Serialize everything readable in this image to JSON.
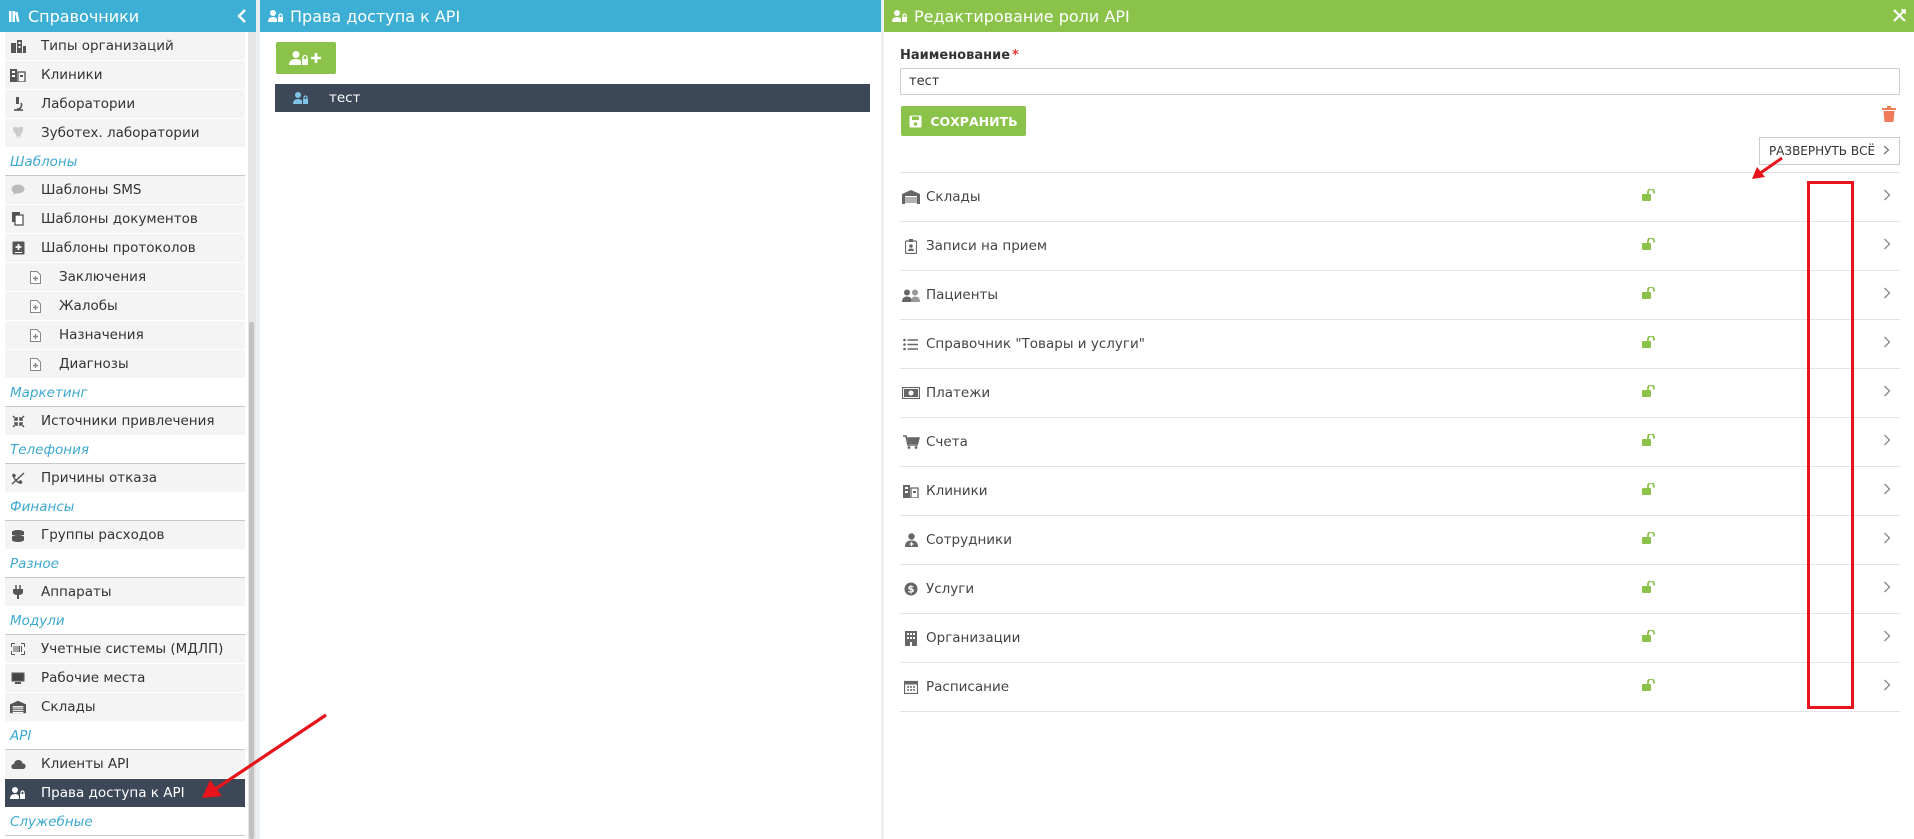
{
  "sidebar": {
    "title": "Справочники",
    "items": [
      {
        "kind": "item",
        "label": "Типы организаций",
        "icon": "buildings-icon"
      },
      {
        "kind": "item",
        "label": "Клиники",
        "icon": "clinic-icon"
      },
      {
        "kind": "item",
        "label": "Лаборатории",
        "icon": "microscope-icon"
      },
      {
        "kind": "item",
        "label": "Зуботех. лаборатории",
        "icon": "tooth-icon"
      },
      {
        "kind": "section",
        "label": "Шаблоны"
      },
      {
        "kind": "item",
        "label": "Шаблоны SMS",
        "icon": "sms-icon"
      },
      {
        "kind": "item",
        "label": "Шаблоны документов",
        "icon": "documents-icon"
      },
      {
        "kind": "item",
        "label": "Шаблоны протоколов",
        "icon": "protocol-icon"
      },
      {
        "kind": "sub",
        "label": "Заключения",
        "icon": "file-icon"
      },
      {
        "kind": "sub",
        "label": "Жалобы",
        "icon": "file-icon"
      },
      {
        "kind": "sub",
        "label": "Назначения",
        "icon": "file-icon"
      },
      {
        "kind": "sub",
        "label": "Диагнозы",
        "icon": "file-icon"
      },
      {
        "kind": "section",
        "label": "Маркетинг"
      },
      {
        "kind": "item",
        "label": "Источники привлечения",
        "icon": "compress-icon"
      },
      {
        "kind": "section",
        "label": "Телефония"
      },
      {
        "kind": "item",
        "label": "Причины отказа",
        "icon": "phone-off-icon"
      },
      {
        "kind": "section",
        "label": "Финансы"
      },
      {
        "kind": "item",
        "label": "Группы расходов",
        "icon": "coins-icon"
      },
      {
        "kind": "section",
        "label": "Разное"
      },
      {
        "kind": "item",
        "label": "Аппараты",
        "icon": "plug-icon"
      },
      {
        "kind": "section",
        "label": "Модули"
      },
      {
        "kind": "item",
        "label": "Учетные системы (МДЛП)",
        "icon": "barcode-icon"
      },
      {
        "kind": "item",
        "label": "Рабочие места",
        "icon": "monitor-icon"
      },
      {
        "kind": "item",
        "label": "Склады",
        "icon": "warehouse-icon"
      },
      {
        "kind": "section",
        "label": "API"
      },
      {
        "kind": "item",
        "label": "Клиенты API",
        "icon": "cloud-icon"
      },
      {
        "kind": "item",
        "label": "Права доступа к API",
        "icon": "user-lock-icon",
        "active": true
      },
      {
        "kind": "section",
        "label": "Служебные"
      }
    ]
  },
  "middle": {
    "title": "Права доступа к API",
    "add_button_icon": "add-user-icon",
    "roles": [
      {
        "label": "тест",
        "icon": "user-lock-icon"
      }
    ]
  },
  "editor": {
    "title": "Редактирование роли API",
    "name_label": "Наименование",
    "required_mark": "*",
    "name_value": "тест",
    "save_label": "СОХРАНИТЬ",
    "expand_label": "РАЗВЕРНУТЬ ВСЁ",
    "lock_color": "#8bc34a",
    "permissions": [
      {
        "label": "Склады",
        "icon": "warehouse-icon"
      },
      {
        "label": "Записи на прием",
        "icon": "badge-icon"
      },
      {
        "label": "Пациенты",
        "icon": "users-icon"
      },
      {
        "label": "Справочник \"Товары и услуги\"",
        "icon": "list-icon"
      },
      {
        "label": "Платежи",
        "icon": "money-icon"
      },
      {
        "label": "Счета",
        "icon": "cart-icon"
      },
      {
        "label": "Клиники",
        "icon": "clinic-icon"
      },
      {
        "label": "Сотрудники",
        "icon": "user-doctor-icon"
      },
      {
        "label": "Услуги",
        "icon": "dollar-icon"
      },
      {
        "label": "Организации",
        "icon": "building-icon"
      },
      {
        "label": "Расписание",
        "icon": "calendar-icon"
      }
    ]
  },
  "colors": {
    "header_blue": "#3dafd4",
    "header_green": "#8bc34a",
    "active_dark": "#3c4757",
    "annotation_red": "#e8141b"
  }
}
